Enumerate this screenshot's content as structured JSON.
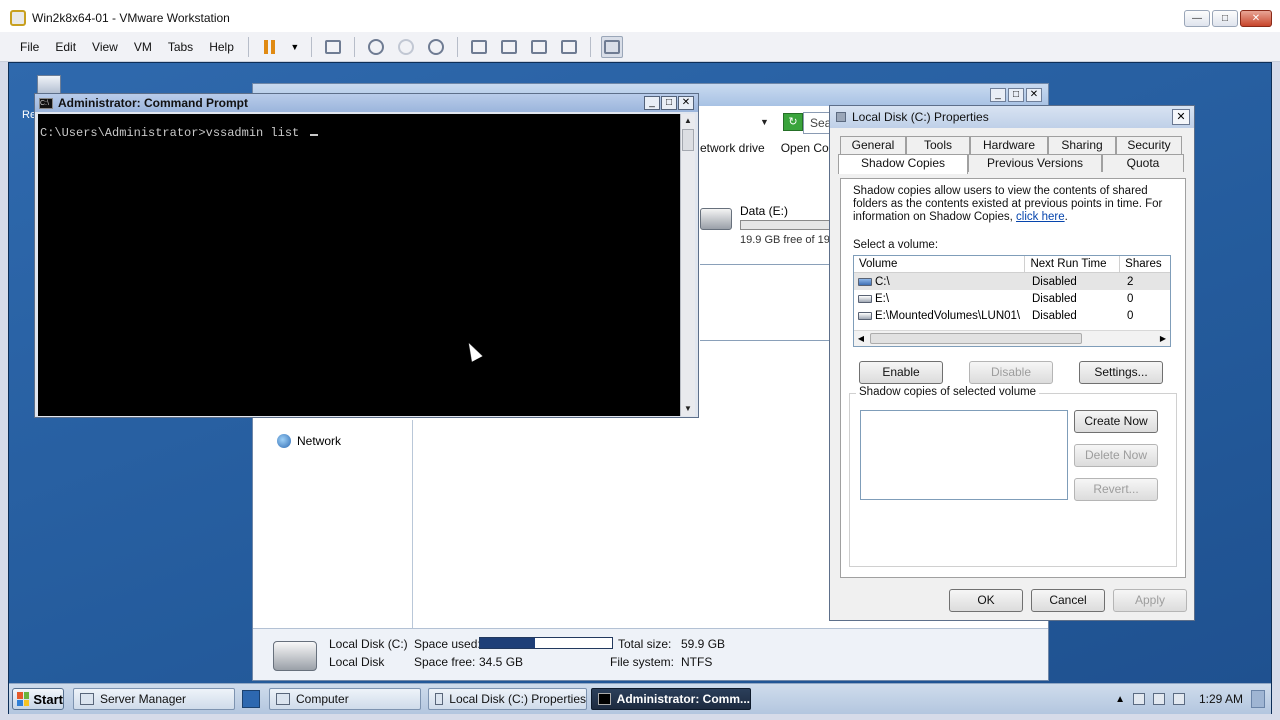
{
  "host": {
    "title": "Win2k8x64-01 - VMware Workstation",
    "menu": [
      "File",
      "Edit",
      "View",
      "VM",
      "Tabs",
      "Help"
    ]
  },
  "desktop": {
    "recycle_label": "Re"
  },
  "explorer": {
    "search_placeholder": "Sear",
    "commands": [
      "etwork drive",
      "Open Co"
    ],
    "drive_e": {
      "name": "Data (E:)",
      "free": "19.9 GB free of 19"
    },
    "nav": {
      "network": "Network"
    },
    "details": {
      "name": "Local Disk (C:)",
      "type": "Local Disk",
      "space_used_label": "Space used:",
      "space_used_fraction": 0.42,
      "space_free_label": "Space free:",
      "space_free": "34.5 GB",
      "total_label": "Total size:",
      "total": "59.9 GB",
      "fs_label": "File system:",
      "fs": "NTFS"
    }
  },
  "cmd": {
    "title": "Administrator: Command Prompt",
    "line": "C:\\Users\\Administrator>vssadmin list "
  },
  "props": {
    "title": "Local Disk (C:) Properties",
    "tabs_row1": [
      "General",
      "Tools",
      "Hardware",
      "Sharing",
      "Security"
    ],
    "tabs_row2": [
      "Shadow Copies",
      "Previous Versions",
      "Quota"
    ],
    "desc": "Shadow copies allow users to view the contents of shared folders as the contents existed at previous points in time. For information on Shadow Copies, ",
    "link": "click here",
    "desc_end": ".",
    "select_label": "Select a volume:",
    "columns": [
      "Volume",
      "Next Run Time",
      "Shares"
    ],
    "volumes": [
      {
        "volume": "C:\\",
        "next": "Disabled",
        "shares": "2"
      },
      {
        "volume": "E:\\",
        "next": "Disabled",
        "shares": "0"
      },
      {
        "volume": "E:\\MountedVolumes\\LUN01\\",
        "next": "Disabled",
        "shares": "0"
      }
    ],
    "btn_enable": "Enable",
    "btn_disable": "Disable",
    "btn_settings": "Settings...",
    "group_label": "Shadow copies of selected volume",
    "btn_create": "Create Now",
    "btn_delete": "Delete Now",
    "btn_revert": "Revert...",
    "btn_ok": "OK",
    "btn_cancel": "Cancel",
    "btn_apply": "Apply"
  },
  "taskbar": {
    "start": "Start",
    "tasks": [
      "Server Manager",
      "Computer",
      "Local Disk (C:) Properties",
      "Administrator: Comm..."
    ],
    "clock": "1:29 AM"
  }
}
